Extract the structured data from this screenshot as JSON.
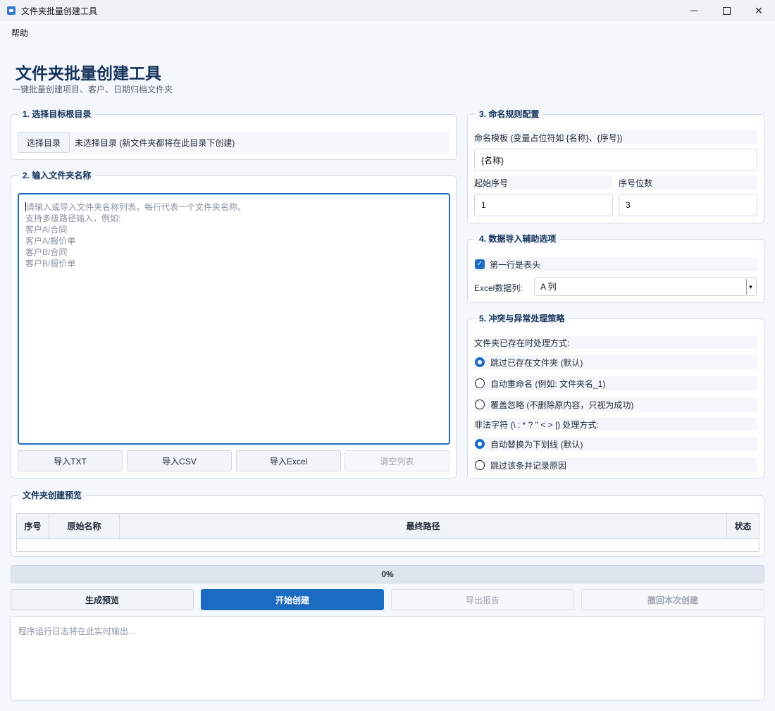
{
  "window": {
    "title": "文件夹批量创建工具"
  },
  "menu": {
    "items": [
      "帮助"
    ]
  },
  "header": {
    "title": "文件夹批量创建工具",
    "subtitle": "一键批量创建项目、客户、日期归档文件夹"
  },
  "section_target": {
    "title": "1. 选择目标根目录",
    "button_label": "选择目录",
    "status_text": "未选择目录 (新文件夹都将在此目录下创建)"
  },
  "section_names": {
    "title": "2. 输入文件夹名称",
    "placeholder_lines": "请输入或导入文件夹名称列表，每行代表一个文件夹名称。\n支持多级路径输入，例如:\n客户A/合同\n客户A/报价单\n客户B/合同\n客户B/报价单",
    "buttons": [
      "导入TXT",
      "导入CSV",
      "导入Excel",
      "清空列表"
    ]
  },
  "section_naming": {
    "title": "3. 命名规则配置",
    "template_label": "命名模板 (变量占位符如 {名称}、{序号})",
    "template_value": "{名称}",
    "start_label": "起始序号",
    "start_value": "1",
    "digits_label": "序号位数",
    "digits_value": "3"
  },
  "section_import": {
    "title": "4. 数据导入辅助选项",
    "header_row_label": "第一行是表头",
    "header_row_checked": true,
    "excel_column_label": "Excel数据列:",
    "excel_column_value": "A 列"
  },
  "section_conflict": {
    "title": "5. 冲突与异常处理策略",
    "exists_label": "文件夹已存在时处理方式:",
    "exists_options": [
      {
        "label": "跳过已存在文件夹 (默认)",
        "selected": true
      },
      {
        "label": "自动重命名 (例如: 文件夹名_1)",
        "selected": false
      },
      {
        "label": "覆盖忽略 (不删除原内容，只视为成功)",
        "selected": false
      }
    ],
    "illegal_label": "非法字符 (\\ : * ? \" < > |) 处理方式:",
    "illegal_options": [
      {
        "label": "自动替换为下划线 (默认)",
        "selected": true
      },
      {
        "label": "跳过该条并记录原因",
        "selected": false
      }
    ]
  },
  "preview": {
    "title": "文件夹创建预览",
    "columns": [
      "序号",
      "原始名称",
      "最终路径",
      "状态"
    ]
  },
  "progress": {
    "percent": 0,
    "text": "0%"
  },
  "actions": [
    "生成预览",
    "开始创建",
    "导出报告",
    "撤回本次创建"
  ],
  "log": {
    "placeholder": "程序运行日志将在此实时输出..."
  },
  "colors": {
    "accent": "#1a6cc2",
    "title": "#14325a",
    "background": "#f4f7fb"
  }
}
